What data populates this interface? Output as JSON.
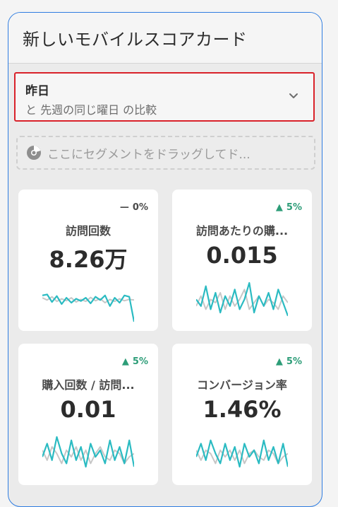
{
  "panel": {
    "title": "新しいモバイルスコアカード"
  },
  "date_range": {
    "label": "昨日",
    "comparison": "と 先週の同じ曜日 の比較"
  },
  "segment_drop": {
    "placeholder": "ここにセグメントをドラッグしてド..."
  },
  "colors": {
    "accent_border": "#2f7de1",
    "selected_outline": "#d9222a",
    "trend_up": "#2d9d78",
    "spark_current": "#2bbbc2",
    "spark_previous": "#c7c7c7"
  },
  "cards": [
    {
      "name": "訪問回数",
      "value": "8.26万",
      "trend": "0%",
      "trend_dir": "flat",
      "spark_current": [
        0.62,
        0.65,
        0.42,
        0.6,
        0.36,
        0.55,
        0.4,
        0.52,
        0.45,
        0.55,
        0.38,
        0.58,
        0.48,
        0.62,
        0.3,
        0.55,
        0.4,
        0.62,
        0.58,
        -0.2
      ],
      "spark_previous": [
        0.55,
        0.48,
        0.58,
        0.44,
        0.52,
        0.46,
        0.55,
        0.42,
        0.5,
        0.44,
        0.56,
        0.46,
        0.52,
        0.4,
        0.5,
        0.44,
        0.52,
        0.46,
        0.5,
        0.48
      ]
    },
    {
      "name": "訪問あたりの購...",
      "value": "0.015",
      "trend": "5%",
      "trend_dir": "up",
      "spark_current": [
        0.5,
        0.3,
        0.9,
        0.2,
        0.7,
        0.1,
        0.6,
        0.3,
        0.8,
        0.2,
        0.5,
        1.0,
        0.1,
        0.6,
        0.3,
        0.7,
        0.2,
        0.8,
        0.4,
        0.0
      ],
      "spark_previous": [
        0.3,
        0.6,
        0.2,
        0.5,
        0.4,
        0.7,
        0.2,
        0.6,
        0.3,
        0.5,
        0.8,
        0.2,
        0.4,
        0.6,
        0.3,
        0.5,
        0.4,
        0.2,
        0.6,
        0.4
      ]
    },
    {
      "name": "購入回数 / 訪問...",
      "value": "0.01",
      "trend": "5%",
      "trend_dir": "up",
      "spark_current": [
        0.4,
        0.8,
        0.3,
        1.0,
        0.5,
        0.2,
        0.9,
        0.3,
        0.7,
        0.1,
        0.8,
        0.4,
        0.6,
        0.2,
        0.9,
        0.3,
        0.7,
        0.2,
        0.9,
        0.1
      ],
      "spark_previous": [
        0.6,
        0.3,
        0.7,
        0.5,
        0.2,
        0.6,
        0.4,
        0.7,
        0.3,
        0.6,
        0.2,
        0.5,
        0.7,
        0.4,
        0.3,
        0.6,
        0.5,
        0.2,
        0.4,
        0.5
      ]
    },
    {
      "name": "コンバージョン率",
      "value": "1.46%",
      "trend": "5%",
      "trend_dir": "up",
      "spark_current": [
        0.4,
        0.8,
        0.3,
        0.9,
        0.5,
        0.2,
        0.8,
        0.3,
        0.7,
        0.1,
        0.8,
        0.4,
        0.6,
        0.2,
        0.9,
        0.3,
        0.7,
        0.2,
        0.8,
        0.1
      ],
      "spark_previous": [
        0.6,
        0.3,
        0.6,
        0.5,
        0.2,
        0.6,
        0.4,
        0.6,
        0.3,
        0.6,
        0.2,
        0.5,
        0.6,
        0.4,
        0.3,
        0.6,
        0.5,
        0.2,
        0.4,
        0.5
      ]
    }
  ]
}
